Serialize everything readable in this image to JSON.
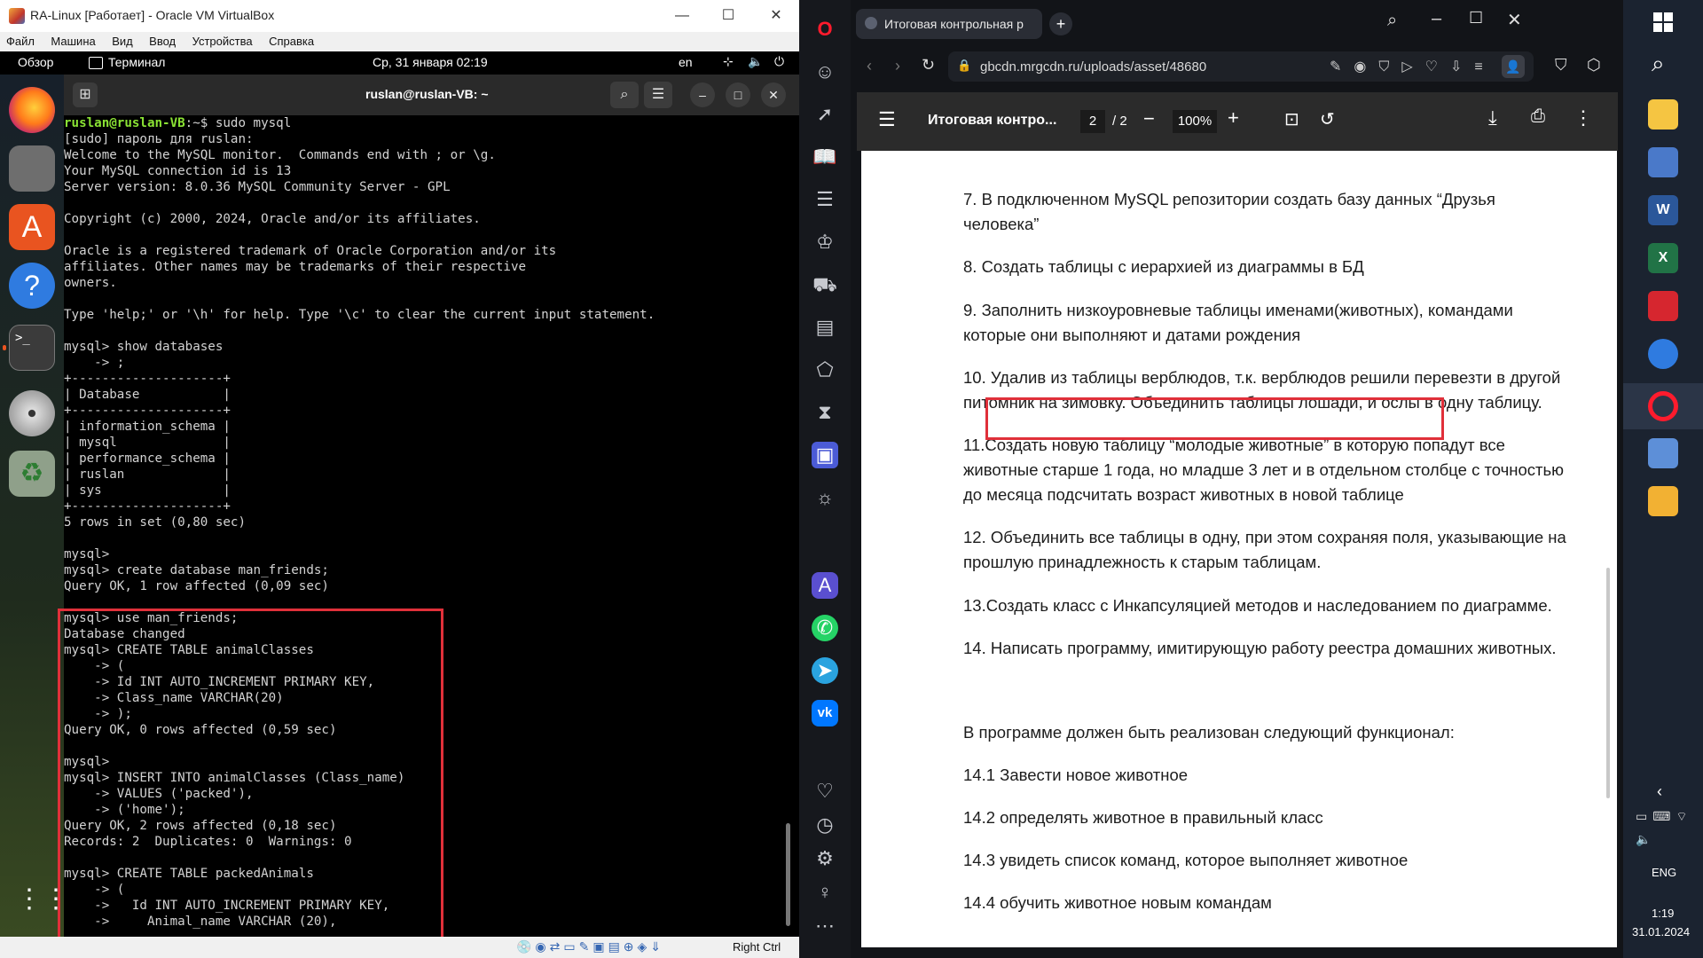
{
  "vbox": {
    "title": "RA-Linux [Работает] - Oracle VM VirtualBox",
    "menu": [
      "Файл",
      "Машина",
      "Вид",
      "Ввод",
      "Устройства",
      "Справка"
    ],
    "status_right": "Right Ctrl"
  },
  "ubuntu_topbar": {
    "overview": "Обзор",
    "app": "Терминал",
    "clock": "Ср, 31 января  02:19",
    "lang": "en"
  },
  "terminal": {
    "title": "ruslan@ruslan-VB: ~",
    "prompt_user": "ruslan@ruslan-VB",
    "prompt_rest": ":~$ sudo mysql",
    "lines": [
      "[sudo] пароль для ruslan:",
      "Welcome to the MySQL monitor.  Commands end with ; or \\g.",
      "Your MySQL connection id is 13",
      "Server version: 8.0.36 MySQL Community Server - GPL",
      "",
      "Copyright (c) 2000, 2024, Oracle and/or its affiliates.",
      "",
      "Oracle is a registered trademark of Oracle Corporation and/or its",
      "affiliates. Other names may be trademarks of their respective",
      "owners.",
      "",
      "Type 'help;' or '\\h' for help. Type '\\c' to clear the current input statement.",
      "",
      "mysql> show databases",
      "    -> ;",
      "+--------------------+",
      "| Database           |",
      "+--------------------+",
      "| information_schema |",
      "| mysql              |",
      "| performance_schema |",
      "| ruslan             |",
      "| sys                |",
      "+--------------------+",
      "5 rows in set (0,80 sec)",
      "",
      "mysql>",
      "mysql> create database man_friends;",
      "Query OK, 1 row affected (0,09 sec)",
      "",
      "mysql> use man_friends;",
      "Database changed",
      "mysql> CREATE TABLE animalClasses",
      "    -> (",
      "    -> Id INT AUTO_INCREMENT PRIMARY KEY,",
      "    -> Class_name VARCHAR(20)",
      "    -> );",
      "Query OK, 0 rows affected (0,59 sec)",
      "",
      "mysql>",
      "mysql> INSERT INTO animalClasses (Class_name)",
      "    -> VALUES ('packed'),",
      "    -> ('home');",
      "Query OK, 2 rows affected (0,18 sec)",
      "Records: 2  Duplicates: 0  Warnings: 0",
      "",
      "mysql> CREATE TABLE packedAnimals",
      "    -> (",
      "    ->   Id INT AUTO_INCREMENT PRIMARY KEY,",
      "    ->     Animal_name VARCHAR (20),"
    ]
  },
  "opera": {
    "tab_title": "Итоговая контрольная р",
    "url": "gbcdn.mrgcdn.ru/uploads/asset/48680",
    "pdf_title": "Итоговая контро...",
    "page_current": "2",
    "page_total": "/ 2",
    "zoom": "100%"
  },
  "pdf": {
    "lines": [
      "7. В подключенном MySQL репозитории создать базу данных “Друзья",
      "человека”",
      "8. Создать таблицы с иерархией из диаграммы в БД",
      "9.  Заполнить низкоуровневые таблицы именами(животных), командами",
      "которые они выполняют и датами рождения",
      "10.  Удалив из таблицы верблюдов, т.к. верблюдов решили перевезти в другой",
      "питомник на зимовку. Объединить таблицы лошади, и ослы в одну таблицу.",
      "11.Создать новую таблицу “молодые животные” в которую попадут все",
      "животные старше 1 года, но младше 3 лет и в отдельном столбце с точностью",
      "до месяца подсчитать возраст животных в новой таблице",
      "12. Объединить все таблицы в одну, при этом сохраняя поля, указывающие на",
      "прошлую принадлежность к старым таблицам.",
      "13.Создать класс с Инкапсуляцией методов и наследованием по диаграмме.",
      "14. Написать программу, имитирующую работу реестра домашних животных.",
      "В программе должен быть реализован следующий функционал:",
      "14.1 Завести новое животное",
      "14.2 определять животное в правильный класс",
      "14.3 увидеть список команд, которое выполняет животное",
      "14.4 обучить животное новым командам"
    ]
  },
  "taskbar": {
    "lang": "ENG",
    "time": "1:19",
    "date": "31.01.2024"
  }
}
